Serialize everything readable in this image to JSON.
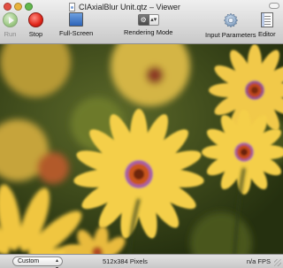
{
  "window": {
    "title": "CIAxialBlur Unit.qtz – Viewer",
    "document_icon": "qtz-document-icon"
  },
  "toolbar": {
    "run_label": "Run",
    "stop_label": "Stop",
    "fullscreen_label": "Full-Screen",
    "rendering_mode_label": "Rendering Mode",
    "rendering_mode_icons": [
      "gear-icon",
      "stepper-icon"
    ],
    "input_parameters_label": "Input Parameters",
    "editor_label": "Editor"
  },
  "canvas": {
    "content": "blurred-yellow-daisies-image"
  },
  "statusbar": {
    "size_popup_value": "Custom",
    "size_text": "512x384 Pixels",
    "fps_text": "n/a FPS"
  },
  "colors": {
    "run_green": "#8cc56b",
    "stop_red": "#e02418",
    "petal_yellow": "#f4cf48",
    "foliage_green": "#3c4a1a"
  }
}
